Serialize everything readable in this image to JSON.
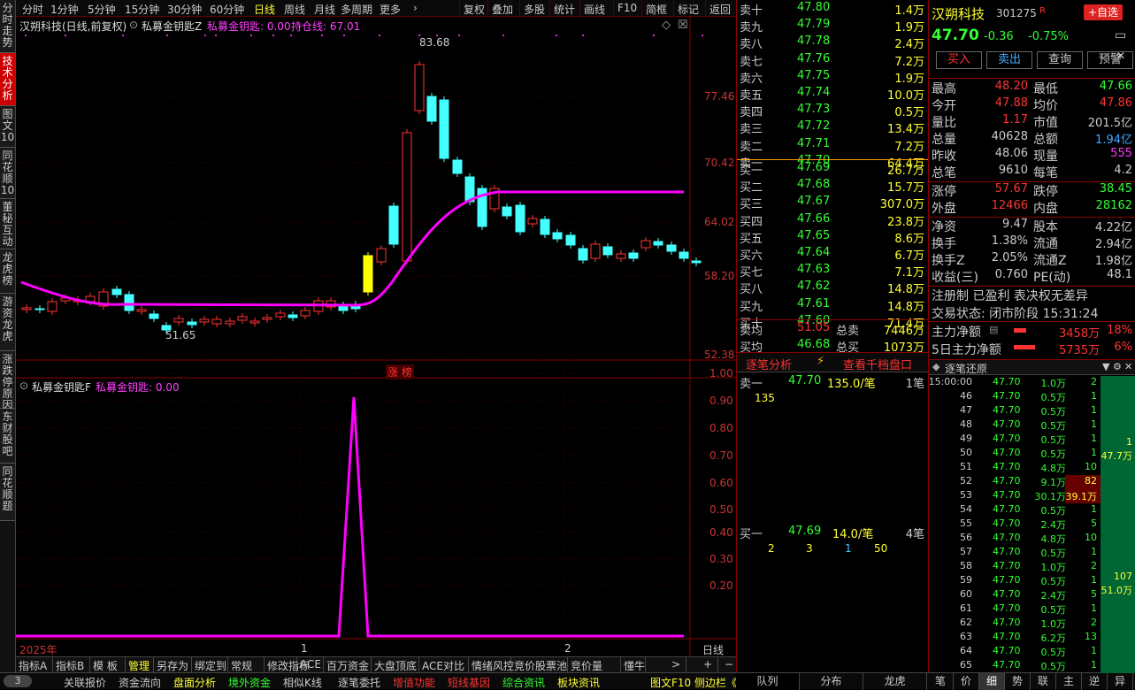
{
  "left_tabs": [
    "分时走势",
    "技术分析",
    "图文10",
    "同花顺10",
    "董秘互动",
    "龙虎榜",
    "游资龙虎",
    "涨跌停原因",
    "东财股吧",
    "同花顺题"
  ],
  "period_tabs": [
    "分时",
    "1分钟",
    "5分钟",
    "15分钟",
    "30分钟",
    "60分钟",
    "日线",
    "周线",
    "月线",
    "多周期",
    "更多"
  ],
  "toolbar_right": [
    "复权",
    "叠加",
    "多股",
    "统计",
    "画线",
    "F10",
    "简框",
    "标记",
    "返回"
  ],
  "main_title": "汉朔科技(日线,前复权)",
  "main_indicator_name": "私募金钥匙Z",
  "main_indicator_value": "私募金钥匙: 0.00",
  "main_indicator_line": "持仓线: 67.01",
  "price_axis": [
    "77.46",
    "70.42",
    "64.02",
    "58.20",
    "52.38"
  ],
  "high_label": "83.68",
  "low_label": "51.65",
  "limit_up_tag": "涨 榜",
  "sub_title": "私募金钥匙F",
  "sub_indicator": "私募金钥匙: 0.00",
  "sub_axis": [
    "1.00",
    "0.90",
    "0.80",
    "0.70",
    "0.60",
    "0.50",
    "0.40",
    "0.30",
    "0.20"
  ],
  "date_year": "2025年",
  "date_marks": [
    "1",
    "2"
  ],
  "period_label": "日线",
  "bottom_tabs": [
    "指标A",
    "指标B",
    "模 板",
    "管理",
    "另存为",
    "绑定到",
    "常规",
    "修改指标",
    "ACE",
    "百万资金",
    "大盘顶底",
    "ACE对比",
    "情绪风控",
    "竞价股票池",
    "竞价量",
    "懂牛"
  ],
  "bottom_controls": [
    ">",
    "+",
    "−"
  ],
  "status_bar": [
    "关联报价",
    "资金流向",
    "盘面分析",
    "境外资金",
    "相似K线",
    "逐笔委托",
    "增值功能",
    "短线基因",
    "综合资讯",
    "板块资讯",
    "图文F10 侧边栏《"
  ],
  "status_circle": "3",
  "orderbook": {
    "sell": [
      [
        "卖十",
        "47.80",
        "1.4万"
      ],
      [
        "卖九",
        "47.79",
        "1.9万"
      ],
      [
        "卖八",
        "47.78",
        "2.4万"
      ],
      [
        "卖七",
        "47.76",
        "7.2万"
      ],
      [
        "卖六",
        "47.75",
        "1.9万"
      ],
      [
        "卖五",
        "47.74",
        "10.0万"
      ],
      [
        "卖四",
        "47.73",
        "0.5万"
      ],
      [
        "卖三",
        "47.72",
        "13.4万"
      ],
      [
        "卖二",
        "47.71",
        "7.2万"
      ],
      [
        "卖一",
        "47.70",
        "64.4万"
      ]
    ],
    "buy": [
      [
        "买一",
        "47.69",
        "26.7万"
      ],
      [
        "买二",
        "47.68",
        "15.7万"
      ],
      [
        "买三",
        "47.67",
        "307.0万"
      ],
      [
        "买四",
        "47.66",
        "23.8万"
      ],
      [
        "买五",
        "47.65",
        "8.6万"
      ],
      [
        "买六",
        "47.64",
        "6.7万"
      ],
      [
        "买七",
        "47.63",
        "7.1万"
      ],
      [
        "买八",
        "47.62",
        "14.8万"
      ],
      [
        "买九",
        "47.61",
        "14.8万"
      ],
      [
        "买十",
        "47.60",
        "71.4万"
      ]
    ],
    "sell_avg_label": "卖均",
    "sell_avg": "51.05",
    "sell_total_label": "总卖",
    "sell_total": "7446万",
    "buy_avg_label": "买均",
    "buy_avg": "46.68",
    "buy_total_label": "总买",
    "buy_total": "1073万"
  },
  "stock": {
    "name": "汉朔科技",
    "code": "301275",
    "badge": "R",
    "add_btn": "+自选",
    "price": "47.70",
    "change": "-0.36",
    "pct": "-0.75%",
    "buttons": [
      "买入",
      "卖出",
      "查询",
      "预警"
    ],
    "stats": [
      [
        "最高",
        "48.20",
        "最低",
        "47.66"
      ],
      [
        "今开",
        "47.88",
        "均价",
        "47.86"
      ],
      [
        "量比",
        "1.17",
        "市值",
        "201.5亿"
      ],
      [
        "总量",
        "40628",
        "总额",
        "1.94亿"
      ],
      [
        "昨收",
        "48.06",
        "现量",
        "555"
      ],
      [
        "总笔",
        "9610",
        "每笔",
        "4.2"
      ]
    ],
    "limits": [
      [
        "涨停",
        "57.67",
        "跌停",
        "38.45"
      ],
      [
        "外盘",
        "12466",
        "内盘",
        "28162"
      ]
    ],
    "fund": [
      [
        "净资",
        "9.47",
        "股本",
        "4.22亿"
      ],
      [
        "换手",
        "1.38%",
        "流通",
        "2.94亿"
      ],
      [
        "换手Z",
        "2.05%",
        "流通Z",
        "1.98亿"
      ],
      [
        "收益(三)",
        "0.760",
        "PE(动)",
        "48.1"
      ]
    ],
    "reg_text": "注册制 已盈利 表决权无差异",
    "trade_status": "交易状态: 闭市阶段 15:31:24",
    "main_flow_label": "主力净额",
    "main_flow": "3458万",
    "main_flow_pct": "18%",
    "main_flow5_label": "5日主力净额",
    "main_flow5": "5735万",
    "main_flow5_pct": "6%"
  },
  "tick_analysis": {
    "title": "逐笔分析",
    "link": "查看千档盘口",
    "sell1_label": "卖一",
    "sell1_price": "47.70",
    "sell1_vol": "135.0/笔",
    "sell1_cnt": "1笔",
    "sell1_q": "135",
    "buy1_label": "买一",
    "buy1_price": "47.69",
    "buy1_vol": "14.0/笔",
    "buy1_cnt": "4笔",
    "buy1_q": [
      "2",
      "3",
      "1",
      "50"
    ]
  },
  "tick_tabs": [
    "队列",
    "分布",
    "龙虎"
  ],
  "ticks_title": "逐笔还原",
  "ticks": [
    [
      "15:00:00",
      "47.70",
      "1.0万",
      "2"
    ],
    [
      "46",
      "47.70",
      "0.5万",
      "1"
    ],
    [
      "47",
      "47.70",
      "0.5万",
      "1"
    ],
    [
      "48",
      "47.70",
      "0.5万",
      "1"
    ],
    [
      "49",
      "47.70",
      "0.5万",
      "1"
    ],
    [
      "50",
      "47.70",
      "0.5万",
      "1"
    ],
    [
      "51",
      "47.70",
      "4.8万",
      "10"
    ],
    [
      "52",
      "47.70",
      "9.1万",
      "82"
    ],
    [
      "53",
      "47.70",
      "30.1万",
      "39.1万"
    ],
    [
      "54",
      "47.70",
      "0.5万",
      "1"
    ],
    [
      "55",
      "47.70",
      "2.4万",
      "5"
    ],
    [
      "56",
      "47.70",
      "4.8万",
      "10"
    ],
    [
      "57",
      "47.70",
      "0.5万",
      "1"
    ],
    [
      "58",
      "47.70",
      "1.0万",
      "2"
    ],
    [
      "59",
      "47.70",
      "0.5万",
      "1"
    ],
    [
      "60",
      "47.70",
      "2.4万",
      "5"
    ],
    [
      "61",
      "47.70",
      "0.5万",
      "1"
    ],
    [
      "62",
      "47.70",
      "1.0万",
      "2"
    ],
    [
      "63",
      "47.70",
      "6.2万",
      "13"
    ],
    [
      "64",
      "47.70",
      "0.5万",
      "1"
    ],
    [
      "65",
      "47.70",
      "0.5万",
      "1"
    ]
  ],
  "tick_side": [
    "1",
    "47.7万",
    "107",
    "51.0万"
  ],
  "bottom_right_tabs": [
    "笔",
    "价",
    "细",
    "势",
    "联",
    "主",
    "逆",
    "异"
  ]
}
